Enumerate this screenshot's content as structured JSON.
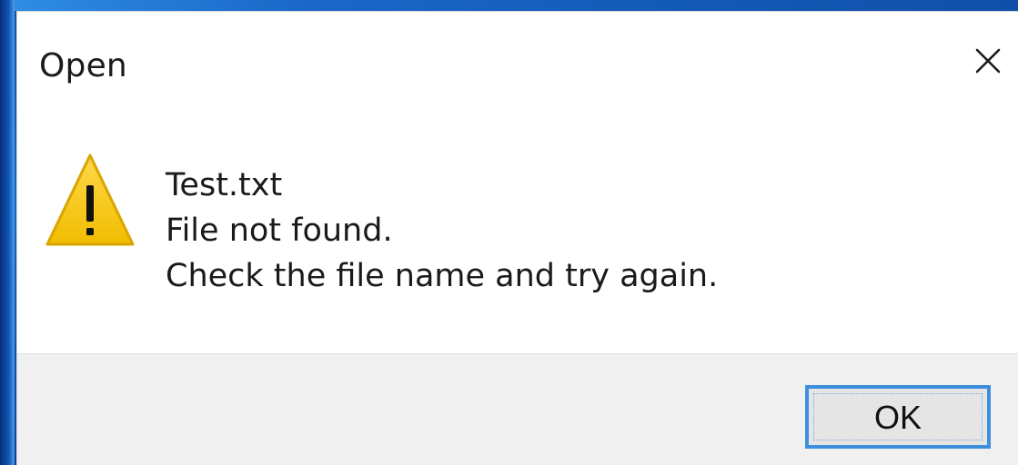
{
  "dialog": {
    "title": "Open",
    "close_icon": "close-icon",
    "warning_icon": "warning-icon",
    "message": {
      "file_name": "Test.txt",
      "line_1": "File not found.",
      "line_2": "Check the file name and try again."
    },
    "ok_label": "OK"
  },
  "colors": {
    "dialog_background": "#ffffff",
    "footer_background": "#f0f0f0",
    "warning_yellow": "#f5c400",
    "warning_outline": "#d9a500",
    "button_border": "#3c8fdd",
    "desktop_blue": "#1466c6"
  }
}
